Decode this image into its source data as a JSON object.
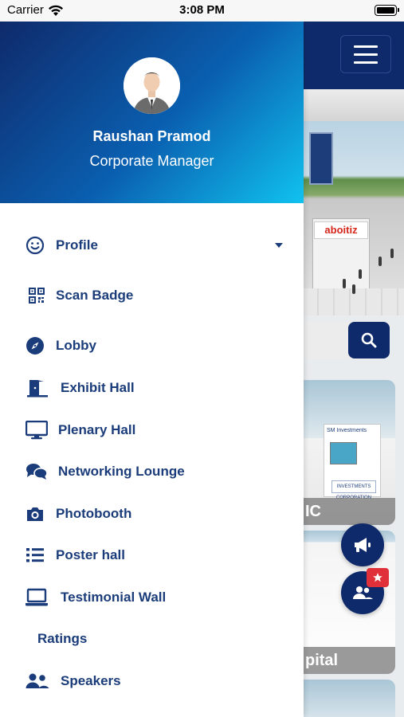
{
  "status_bar": {
    "carrier": "Carrier",
    "time": "3:08 PM"
  },
  "drawer": {
    "user": {
      "name": "Raushan Pramod",
      "role": "Corporate Manager"
    },
    "menu": [
      {
        "label": "Profile",
        "icon": "smile-icon",
        "has_dropdown": true
      },
      {
        "label": "Scan Badge",
        "icon": "qrcode-icon"
      },
      {
        "label": "Lobby",
        "icon": "compass-icon"
      },
      {
        "label": "Exhibit Hall",
        "icon": "door-open-icon"
      },
      {
        "label": "Plenary Hall",
        "icon": "desktop-icon"
      },
      {
        "label": "Networking Lounge",
        "icon": "chat-bubbles-icon"
      },
      {
        "label": "Photobooth",
        "icon": "camera-icon"
      },
      {
        "label": "Poster hall",
        "icon": "list-icon"
      },
      {
        "label": "Testimonial Wall",
        "icon": "laptop-icon"
      },
      {
        "label": "Ratings",
        "icon": ""
      },
      {
        "label": "Speakers",
        "icon": "users-icon"
      }
    ]
  },
  "background": {
    "booth_sign": "aboitiz",
    "card1_panel_title": "SM Investments",
    "card1_logo_text": "INVESTMENTS CORPORATION",
    "card1_caption": "IC",
    "card2_caption": "pital"
  },
  "colors": {
    "brand_navy": "#0f2a6b",
    "menu_text": "#1b3c7a",
    "header_gradient_start": "#0f2a6b",
    "header_gradient_end": "#10c2ef",
    "badge_red": "#e0303a"
  }
}
